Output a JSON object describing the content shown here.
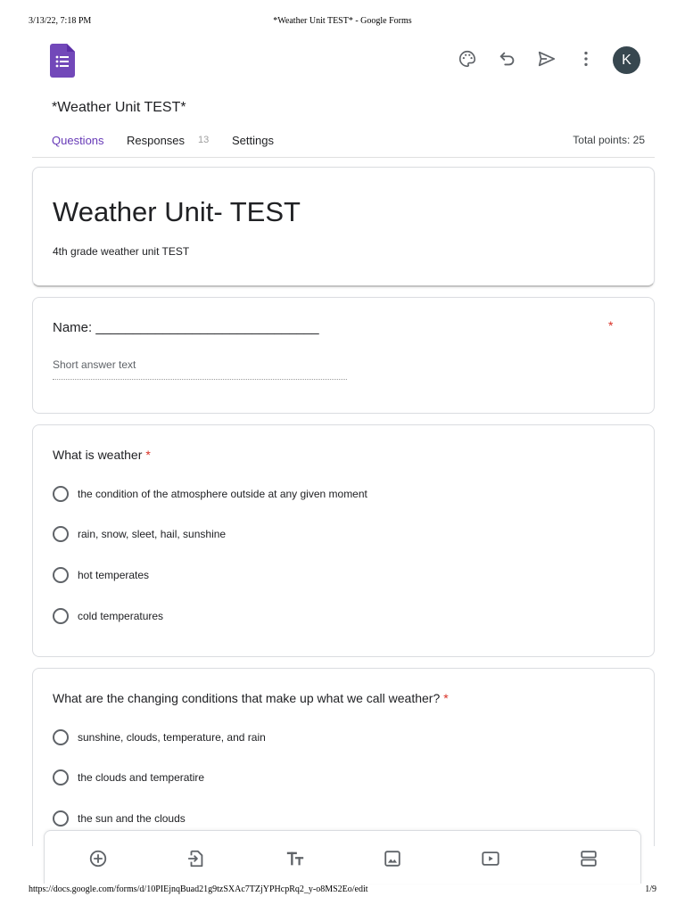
{
  "print_header": {
    "datetime": "3/13/22, 7:18 PM",
    "page_title": "*Weather Unit TEST* - Google Forms"
  },
  "print_footer": {
    "url": "https://docs.google.com/forms/d/10PIEjnqBuad21g9tzSXAc7TZjYPHcpRq2_y-o8MS2Eo/edit",
    "page": "1/9"
  },
  "header": {
    "doc_title": "*Weather Unit TEST*",
    "avatar_initial": "K",
    "icons": [
      "palette-icon",
      "undo-icon",
      "send-icon",
      "more-vert-icon"
    ]
  },
  "tabs": {
    "questions": "Questions",
    "responses": "Responses",
    "responses_count": "13",
    "settings": "Settings",
    "total_points": "Total points: 25"
  },
  "form": {
    "title": "Weather Unit- TEST",
    "description": "4th grade weather unit TEST"
  },
  "questions": [
    {
      "text": "Name: ______________________________",
      "required_mark": "*",
      "placeholder": "Short answer text"
    },
    {
      "text": "What is weather",
      "required_mark": "*",
      "options": [
        "the condition of the atmosphere outside at any given moment",
        "rain, snow, sleet, hail, sunshine",
        "hot temperates",
        "cold temperatures"
      ]
    },
    {
      "text": "What are the changing conditions that make up what we call weather?",
      "required_mark": "*",
      "options": [
        "sunshine, clouds, temperature, and rain",
        "the clouds and temperatire",
        "the sun and the clouds"
      ]
    }
  ],
  "bottom_toolbar": {
    "icons": [
      "add-question-icon",
      "import-questions-icon",
      "add-title-icon",
      "add-image-icon",
      "add-video-icon",
      "add-section-icon"
    ]
  },
  "colors": {
    "accent": "#673ab7",
    "required": "#d93025",
    "avatar": "#37474f"
  }
}
